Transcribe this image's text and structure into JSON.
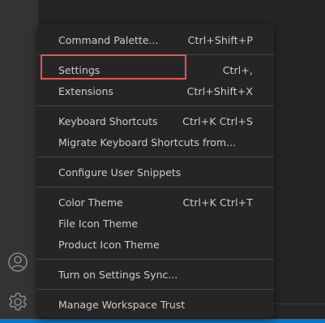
{
  "menu": {
    "items": [
      {
        "label": "Command Palette...",
        "shortcut": "Ctrl+Shift+P"
      },
      {
        "label": "Settings",
        "shortcut": "Ctrl+,"
      },
      {
        "label": "Extensions",
        "shortcut": "Ctrl+Shift+X"
      },
      {
        "label": "Keyboard Shortcuts",
        "shortcut": "Ctrl+K Ctrl+S"
      },
      {
        "label": "Migrate Keyboard Shortcuts from...",
        "shortcut": ""
      },
      {
        "label": "Configure User Snippets",
        "shortcut": ""
      },
      {
        "label": "Color Theme",
        "shortcut": "Ctrl+K Ctrl+T"
      },
      {
        "label": "File Icon Theme",
        "shortcut": ""
      },
      {
        "label": "Product Icon Theme",
        "shortcut": ""
      },
      {
        "label": "Turn on Settings Sync...",
        "shortcut": ""
      },
      {
        "label": "Manage Workspace Trust",
        "shortcut": ""
      }
    ]
  },
  "activity_bar": {
    "icons": [
      "account-icon",
      "gear-icon"
    ]
  },
  "colors": {
    "menu_bg": "#252526",
    "text": "#cccccc",
    "separator": "#454545",
    "highlight_border": "#e65356",
    "activity_bar": "#333333",
    "status_bar": "#007acc"
  }
}
